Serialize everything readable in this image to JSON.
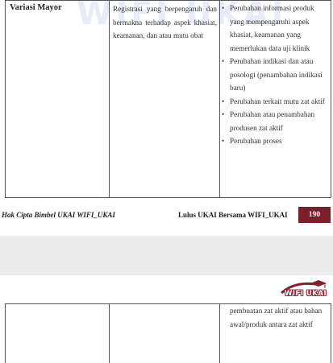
{
  "page1": {
    "watermark": "WIFI UKAI",
    "row": {
      "category": "Variasi Mayor",
      "definition": "Registrasi yang berpengaruh dan bermakna terhadap aspek khasiat, keamanan, dan atau mutu obat",
      "examples": [
        "Perubahan informasi produk yang mempengaruhi aspek khasiat, keamanan yang memerlukan data uji klinik",
        "Perubahan indikasi dan atau posologi (penambahan indikasi baru)",
        "Perubahan terkait mutu zat aktif",
        "Perubahan atau penambahan produsen zat aktif",
        "Perubahan proses"
      ]
    },
    "footer": {
      "left": "Hak Cipta Bimbel UKAI WIFI_UKAI",
      "middle": "Lulus UKAI Bersama WIFI_UKAI",
      "page_number": "190"
    }
  },
  "page2": {
    "logo_text": "WIFI UKAI",
    "continued_text": "pembuatan zat aktif atau bahan awal/produk antara zat aktif"
  },
  "colors": {
    "page_number_bg": "#7a1f2b",
    "logo_accent": "#8a1c2c",
    "gap": "#ececec"
  }
}
